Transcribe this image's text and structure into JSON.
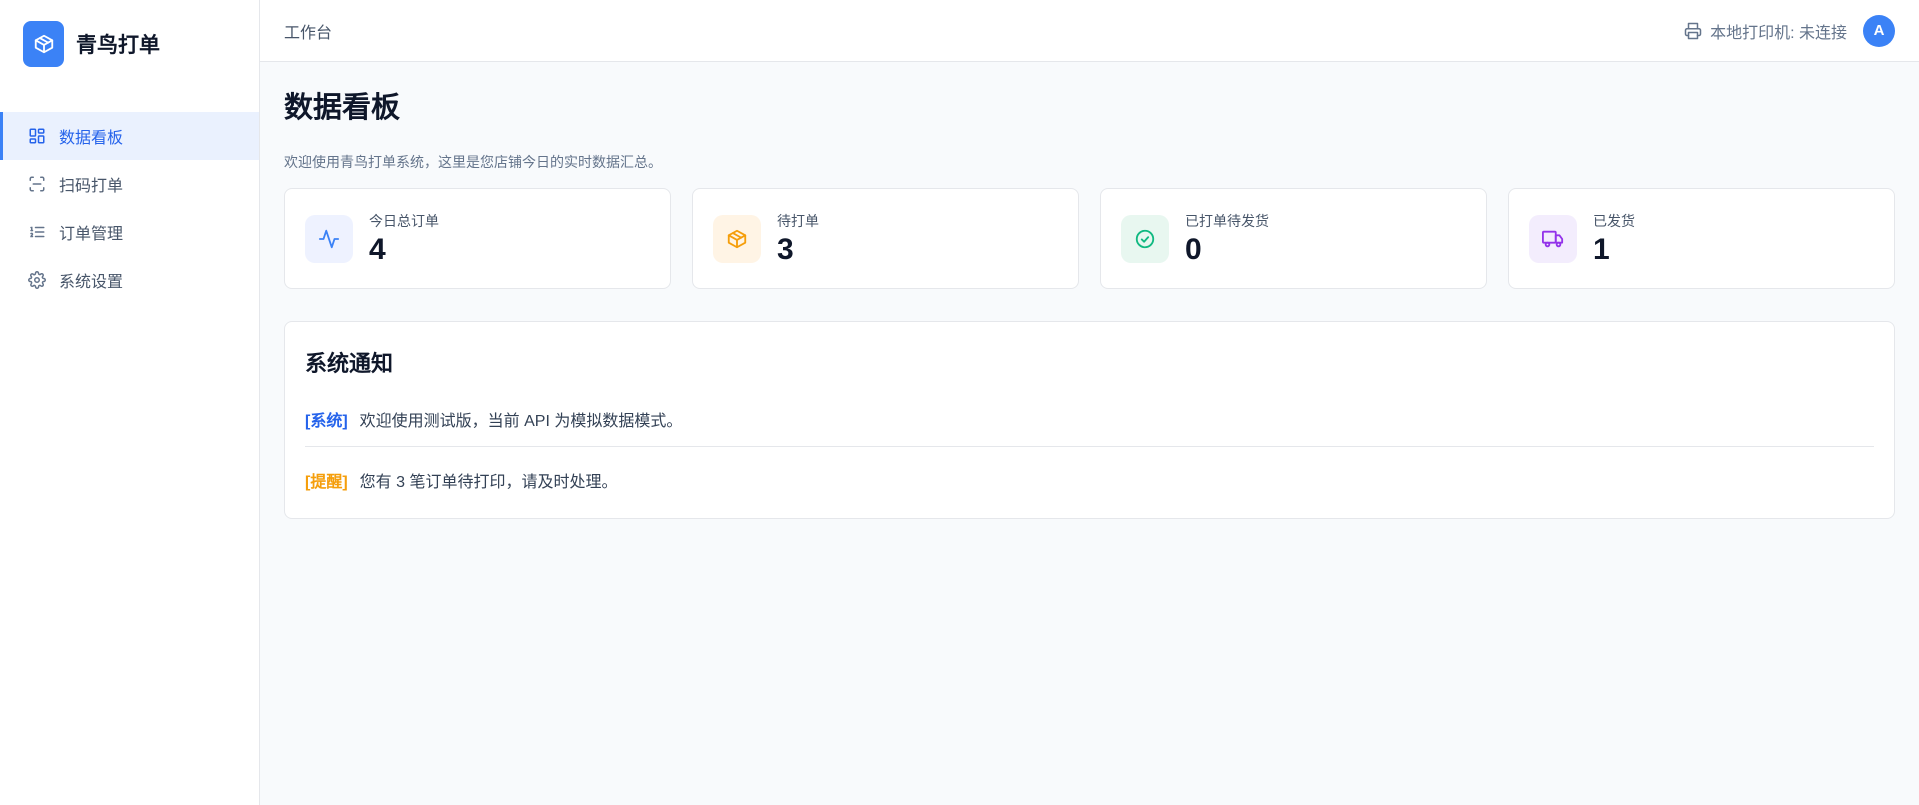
{
  "brand": {
    "name": "青鸟打单"
  },
  "sidebar": {
    "items": [
      {
        "label": "数据看板",
        "icon": "dashboard-icon",
        "active": true
      },
      {
        "label": "扫码打单",
        "icon": "scan-icon",
        "active": false
      },
      {
        "label": "订单管理",
        "icon": "list-icon",
        "active": false
      },
      {
        "label": "系统设置",
        "icon": "gear-icon",
        "active": false
      }
    ]
  },
  "header": {
    "title": "工作台",
    "printer_status": "本地打印机: 未连接",
    "avatar_initial": "A"
  },
  "page": {
    "title": "数据看板",
    "subtitle": "欢迎使用青鸟打单系统，这里是您店铺今日的实时数据汇总。"
  },
  "stats": [
    {
      "label": "今日总订单",
      "value": "4",
      "icon": "activity-icon",
      "bg": "#eef2ff",
      "color": "#3b82f6"
    },
    {
      "label": "待打单",
      "value": "3",
      "icon": "package-icon",
      "bg": "#fff4e5",
      "color": "#f59e0b"
    },
    {
      "label": "已打单待发货",
      "value": "0",
      "icon": "check-circle-icon",
      "bg": "#e8f7f0",
      "color": "#10b981"
    },
    {
      "label": "已发货",
      "value": "1",
      "icon": "truck-icon",
      "bg": "#f3edfd",
      "color": "#9333ea"
    }
  ],
  "notice": {
    "title": "系统通知",
    "items": [
      {
        "tag": "[系统]",
        "text": "欢迎使用测试版，当前 API 为模拟数据模式。",
        "tag_color": "#2563eb"
      },
      {
        "tag": "[提醒]",
        "text": "您有 3 笔订单待打印，请及时处理。",
        "tag_color": "#f59e0b"
      }
    ]
  },
  "colors": {
    "accent": "#3b82f6",
    "sidebar_active_bg": "#eaf1fe",
    "page_bg": "#f8fafc"
  }
}
